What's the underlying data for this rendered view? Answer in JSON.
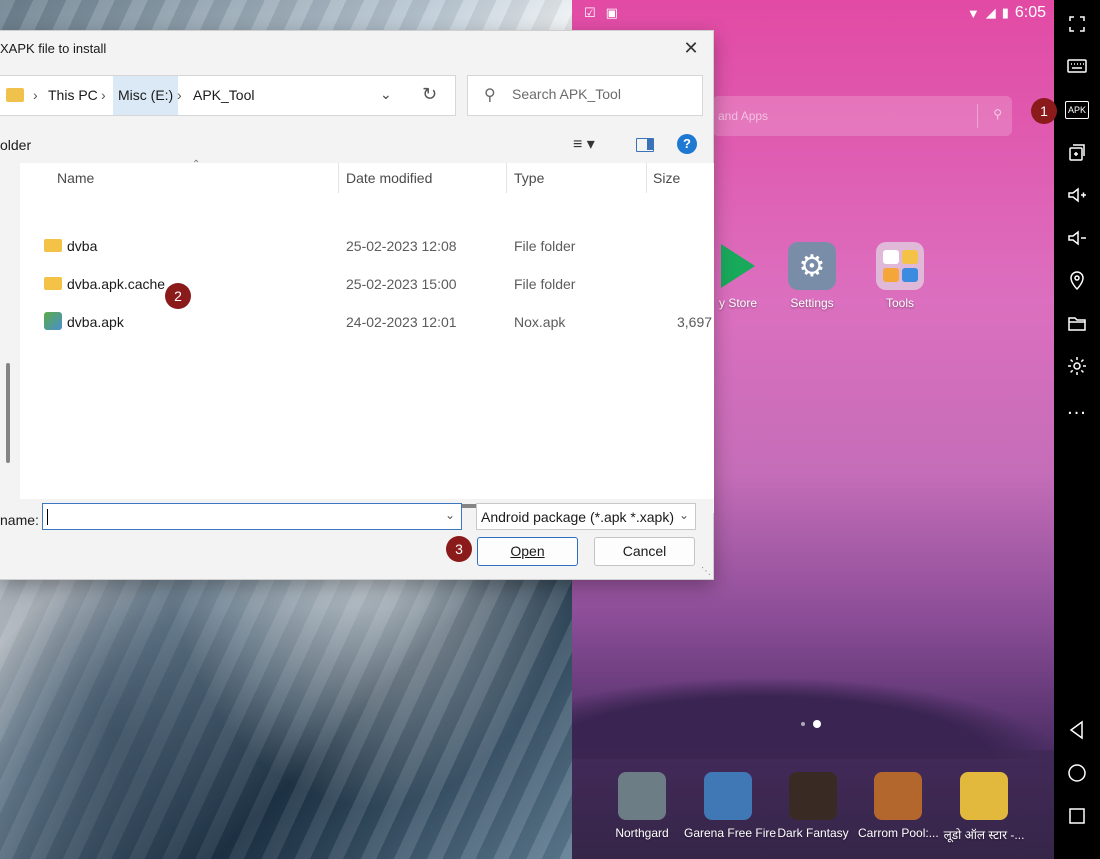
{
  "dialog": {
    "title": "XAPK file to install",
    "breadcrumb": [
      "This PC",
      "Misc (E:)",
      "APK_Tool"
    ],
    "search_placeholder": "Search APK_Tool",
    "new_folder_label": "older",
    "columns": [
      "Name",
      "Date modified",
      "Type",
      "Size"
    ],
    "files": [
      {
        "name": "dvba",
        "date": "25-02-2023 12:08",
        "type": "File folder",
        "size": "",
        "icon": "folder-icon"
      },
      {
        "name": "dvba.apk.cache",
        "date": "25-02-2023 15:00",
        "type": "File folder",
        "size": "",
        "icon": "folder-icon"
      },
      {
        "name": "dvba.apk",
        "date": "24-02-2023 12:01",
        "type": "Nox.apk",
        "size": "3,697",
        "icon": "apk-file-icon"
      }
    ],
    "file_name_label": "name:",
    "file_name_value": "",
    "file_type": "Android package (*.apk *.xapk)",
    "open_label": "Open",
    "cancel_label": "Cancel"
  },
  "annotations": [
    "1",
    "2",
    "3"
  ],
  "android": {
    "time": "6:05",
    "search_hint": "and Apps",
    "home_apps": [
      {
        "label": "y Store",
        "icon": "play-store-icon"
      },
      {
        "label": "Settings",
        "icon": "settings-icon"
      },
      {
        "label": "Tools",
        "icon": "tools-folder-icon"
      }
    ],
    "dock_apps": [
      {
        "label": "Northgard",
        "color": "#6d7d86"
      },
      {
        "label": "Garena Free Fire",
        "color": "#3f78b5"
      },
      {
        "label": "Dark Fantasy",
        "color": "#3a2a24"
      },
      {
        "label": "Carrom Pool:...",
        "color": "#b3672d"
      },
      {
        "label": "लूडो ऑल स्टार -...",
        "color": "#e2b93c"
      }
    ]
  },
  "sidebar": {
    "apk_label": "APK",
    "more_label": "..."
  }
}
